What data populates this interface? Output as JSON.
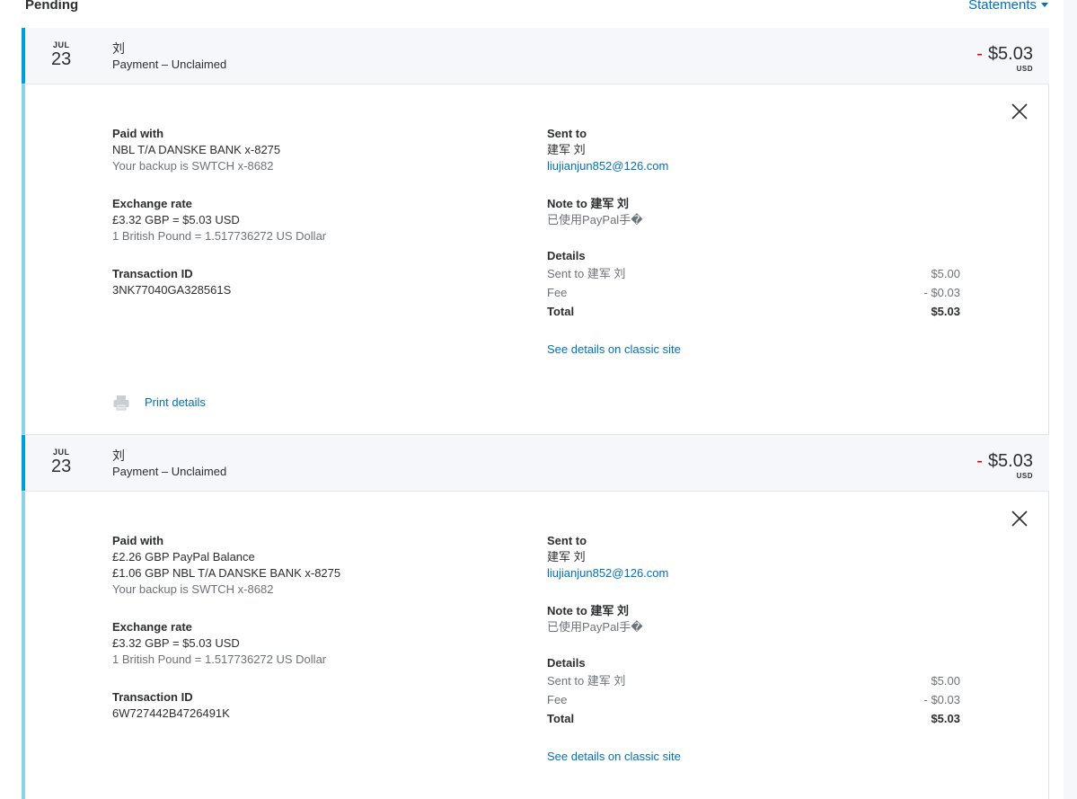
{
  "header": {
    "title": "Pending",
    "statements_label": "Statements"
  },
  "transactions": [
    {
      "month": "JUL",
      "day": "23",
      "name": "刘",
      "type": "Payment – Unclaimed",
      "amount_sign": "-",
      "amount": "$5.03",
      "currency": "USD",
      "paid_with_label": "Paid with",
      "paid_with_lines": [
        "NBL T/A DANSKE BANK x-8275"
      ],
      "backup": "Your backup is SWTCH x-8682",
      "exchange_label": "Exchange rate",
      "exchange_value": "£3.32 GBP = $5.03 USD",
      "exchange_detail": "1 British Pound = 1.517736272 US Dollar",
      "txn_id_label": "Transaction ID",
      "txn_id": "3NK77040GA328561S",
      "sent_to_label": "Sent to",
      "recipient_name": "建军 刘",
      "recipient_email": "liujianjun852@126.com",
      "note_label": "Note to 建军 刘",
      "note_text": "已使用PayPal手�",
      "details_label": "Details",
      "details_rows": [
        {
          "label": "Sent to 建军 刘",
          "value": "$5.00"
        },
        {
          "label": "Fee",
          "value": "- $0.03"
        },
        {
          "label": "Total",
          "value": "$5.03"
        }
      ],
      "classic_link": "See details on classic site",
      "print_label": "Print details"
    },
    {
      "month": "JUL",
      "day": "23",
      "name": "刘",
      "type": "Payment – Unclaimed",
      "amount_sign": "-",
      "amount": "$5.03",
      "currency": "USD",
      "paid_with_label": "Paid with",
      "paid_with_lines": [
        "£2.26 GBP PayPal Balance",
        "£1.06 GBP NBL T/A DANSKE BANK x-8275"
      ],
      "backup": "Your backup is SWTCH x-8682",
      "exchange_label": "Exchange rate",
      "exchange_value": "£3.32 GBP = $5.03 USD",
      "exchange_detail": "1 British Pound = 1.517736272 US Dollar",
      "txn_id_label": "Transaction ID",
      "txn_id": "6W727442B4726491K",
      "sent_to_label": "Sent to",
      "recipient_name": "建军 刘",
      "recipient_email": "liujianjun852@126.com",
      "note_label": "Note to 建军 刘",
      "note_text": "已使用PayPal手�",
      "details_label": "Details",
      "details_rows": [
        {
          "label": "Sent to 建军 刘",
          "value": "$5.00"
        },
        {
          "label": "Fee",
          "value": "- $0.03"
        },
        {
          "label": "Total",
          "value": "$5.03"
        }
      ],
      "classic_link": "See details on classic site"
    }
  ],
  "colors": {
    "accent_blue": "#009cde",
    "link_blue": "#0070ba",
    "negative_red": "#d20000",
    "header_bg": "#f5f7fa"
  }
}
